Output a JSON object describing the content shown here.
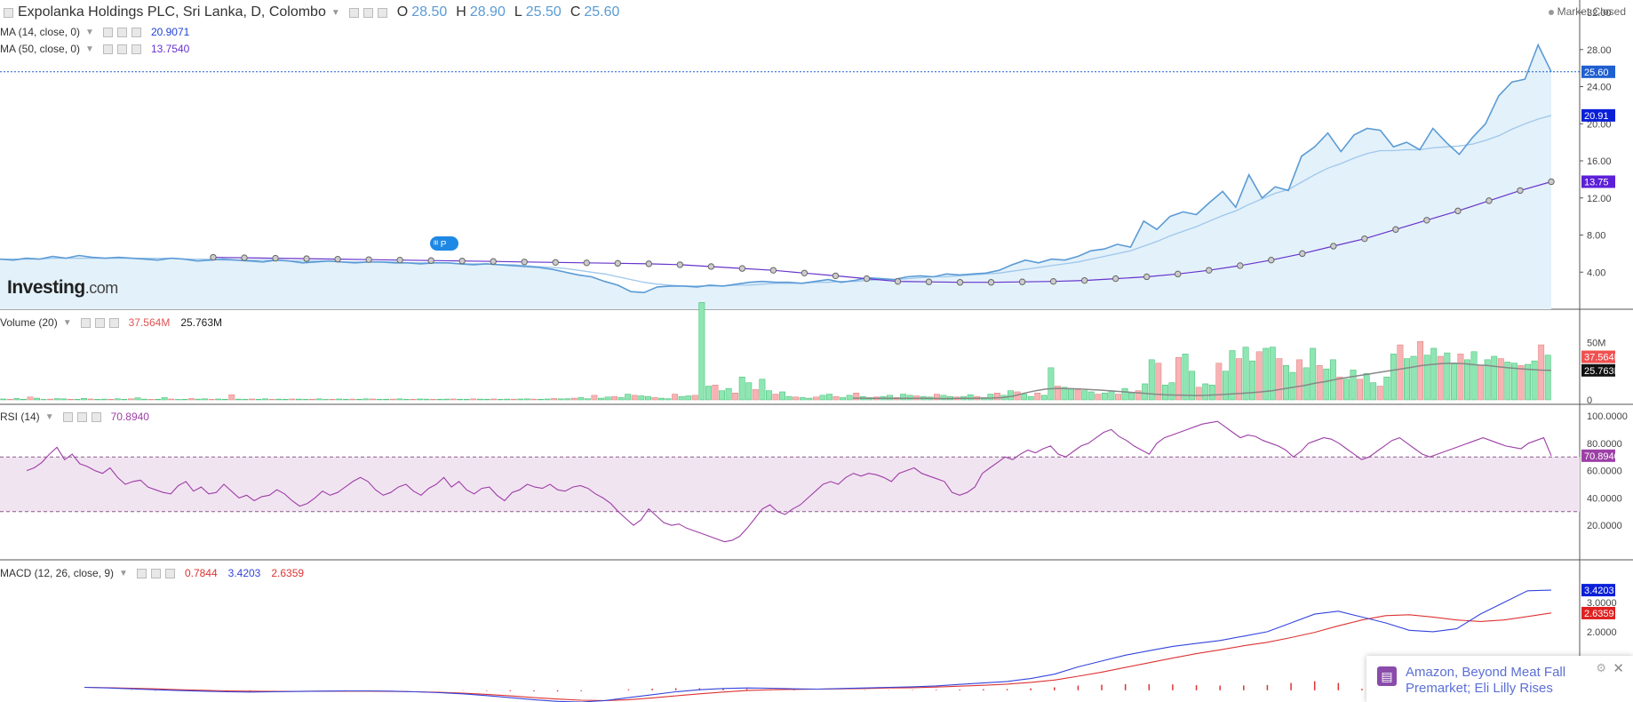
{
  "header": {
    "symbol": "Expolanka Holdings PLC, Sri Lanka, D, Colombo",
    "o_label": "O",
    "o_value": "28.50",
    "h_label": "H",
    "h_value": "28.90",
    "l_label": "L",
    "l_value": "25.50",
    "c_label": "C",
    "c_value": "25.60",
    "market_status": "Market Closed",
    "logo_main": "Investing",
    "logo_domain": ".com",
    "ma14_label": "MA (14, close, 0)",
    "ma14_value": "20.9071",
    "ma50_label": "MA (50, close, 0)",
    "ma50_value": "13.7540",
    "volume_label": "Volume (20)",
    "volume_value1": "37.564M",
    "volume_value2": "25.763M",
    "rsi_label": "RSI (14)",
    "rsi_value": "70.8940",
    "macd_label": "MACD (12, 26, close, 9)",
    "macd_hist": "0.7844",
    "macd_line": "3.4203",
    "macd_signal": "2.6359",
    "marker_text": "ᴵᴵᴵ P"
  },
  "colors": {
    "price": "#5b9bd5",
    "price_fill": "#e3f1fa",
    "ma14": "#9fc7ec",
    "ma50": "#6633cc",
    "vol_up": "#8ee6b2",
    "vol_down": "#f7b3b3",
    "vol_ma": "#888888",
    "rsi": "#9d3fa6",
    "rsi_band": "#f1e4f1",
    "macd": "#3344dd",
    "signal": "#dd3333",
    "hist": "#dd3333",
    "tag_blue": "#1f5fd0",
    "tag_dark": "#0a1fd8",
    "tag_purple": "#5c1fd8"
  },
  "chart_data": [
    {
      "type": "line",
      "name": "price",
      "ylim": [
        0,
        32
      ],
      "yticks": [
        "4.00",
        "8.00",
        "12.00",
        "16.00",
        "20.00",
        "24.00",
        "28.00",
        "32.00"
      ],
      "tags": {
        "price": "25.60",
        "ma14": "20.91",
        "ma50": "13.75"
      },
      "series": [
        {
          "name": "price",
          "values": [
            5.4,
            5.3,
            5.5,
            5.4,
            5.7,
            5.5,
            5.8,
            5.6,
            5.5,
            5.6,
            5.5,
            5.4,
            5.3,
            5.5,
            5.4,
            5.2,
            5.3,
            5.4,
            5.3,
            5.2,
            5.1,
            5.3,
            5.2,
            5.0,
            5.1,
            5.2,
            5.1,
            5.0,
            5.1,
            5.1,
            5.0,
            5.0,
            4.9,
            5.0,
            5.0,
            4.9,
            4.8,
            4.9,
            4.8,
            4.7,
            4.6,
            4.5,
            4.3,
            4.0,
            3.7,
            3.5,
            3.0,
            2.6,
            1.9,
            1.8,
            2.4,
            2.5,
            2.5,
            2.4,
            2.6,
            2.5,
            2.7,
            2.9,
            3.0,
            2.9,
            2.9,
            2.8,
            3.0,
            3.2,
            2.9,
            3.1,
            3.4,
            3.3,
            3.2,
            3.5,
            3.6,
            3.5,
            3.8,
            3.7,
            3.8,
            3.9,
            4.2,
            4.8,
            5.3,
            5.0,
            5.4,
            5.3,
            5.7,
            6.3,
            6.5,
            7.0,
            6.7,
            9.5,
            8.6,
            10.0,
            10.5,
            10.2,
            11.5,
            12.7,
            11.0,
            14.5,
            12.0,
            13.2,
            12.8,
            16.5,
            17.5,
            19.0,
            17.0,
            18.8,
            19.5,
            19.3,
            17.5,
            18.0,
            17.2,
            19.5,
            18.0,
            16.7,
            18.5,
            20.0,
            23.0,
            24.5,
            24.8,
            28.5,
            25.6
          ]
        },
        {
          "name": "ma14",
          "values": [
            5.4,
            5.4,
            5.4,
            5.4,
            5.5,
            5.5,
            5.5,
            5.5,
            5.5,
            5.5,
            5.5,
            5.5,
            5.5,
            5.5,
            5.4,
            5.4,
            5.4,
            5.3,
            5.3,
            5.3,
            5.3,
            5.3,
            5.2,
            5.2,
            5.2,
            5.2,
            5.1,
            5.1,
            5.1,
            5.1,
            5.1,
            5.0,
            5.0,
            5.0,
            5.0,
            4.9,
            4.9,
            4.9,
            4.8,
            4.8,
            4.7,
            4.6,
            4.5,
            4.4,
            4.2,
            4.0,
            3.8,
            3.5,
            3.2,
            2.9,
            2.7,
            2.6,
            2.5,
            2.5,
            2.5,
            2.5,
            2.6,
            2.6,
            2.7,
            2.8,
            2.8,
            2.8,
            2.9,
            2.9,
            3.0,
            3.0,
            3.1,
            3.2,
            3.2,
            3.3,
            3.4,
            3.5,
            3.5,
            3.6,
            3.7,
            3.8,
            3.9,
            4.1,
            4.3,
            4.5,
            4.7,
            4.9,
            5.1,
            5.4,
            5.7,
            6.0,
            6.3,
            6.8,
            7.3,
            7.9,
            8.4,
            8.9,
            9.5,
            10.1,
            10.6,
            11.3,
            11.9,
            12.5,
            12.9,
            13.7,
            14.5,
            15.2,
            15.7,
            16.3,
            16.8,
            17.1,
            17.1,
            17.2,
            17.2,
            17.4,
            17.5,
            17.6,
            17.8,
            18.2,
            18.7,
            19.4,
            20.0,
            20.5,
            20.9
          ]
        },
        {
          "name": "ma50",
          "values": [
            5.6,
            5.55,
            5.5,
            5.45,
            5.4,
            5.35,
            5.3,
            5.25,
            5.2,
            5.15,
            5.1,
            5.05,
            5.0,
            4.95,
            4.9,
            4.8,
            4.6,
            4.4,
            4.2,
            3.9,
            3.6,
            3.3,
            3.0,
            2.95,
            2.9,
            2.9,
            2.95,
            3.0,
            3.1,
            3.3,
            3.5,
            3.8,
            4.2,
            4.7,
            5.3,
            6.0,
            6.8,
            7.6,
            8.6,
            9.6,
            10.6,
            11.7,
            12.8,
            13.75
          ]
        }
      ]
    },
    {
      "type": "bar",
      "name": "volume",
      "ylim": [
        0,
        62
      ],
      "yticks": [
        "0",
        "25M",
        "50M"
      ],
      "tags": {
        "v1": "37.564M",
        "v2": "25.763M"
      },
      "series": [
        {
          "name": "volume",
          "values": [
            0.8,
            0.5,
            1.2,
            0.6,
            2.5,
            1.5,
            0.4,
            0.7,
            1.1,
            0.9,
            0.6,
            0.5,
            1.3,
            0.8,
            0.5,
            0.7,
            0.6,
            1.0,
            0.5,
            0.9,
            1.8,
            0.7,
            0.5,
            0.6,
            2.0,
            0.8,
            0.4,
            0.6,
            1.2,
            0.7,
            0.9,
            0.5,
            0.8,
            0.6,
            4.5,
            0.7,
            0.5,
            0.8,
            0.6,
            0.9,
            0.5,
            0.7,
            0.6,
            0.8,
            0.7,
            0.5,
            0.6,
            0.9,
            0.4,
            0.6,
            0.8,
            0.5,
            0.7,
            0.6,
            0.9,
            0.8,
            0.5,
            0.6,
            0.7,
            0.9,
            0.5,
            0.6,
            0.8,
            0.7,
            0.5,
            0.6,
            0.7,
            0.8,
            0.6,
            0.5,
            0.9,
            0.7,
            0.6,
            0.8,
            0.5,
            0.7,
            0.6,
            0.8,
            0.9,
            0.7,
            0.6,
            0.8,
            1.2,
            0.9,
            1.0,
            1.5,
            2.0,
            1.0,
            4.0,
            1.5,
            2.5,
            3.0,
            2.0,
            5.0,
            4.0,
            3.5,
            3.0,
            2.0,
            1.5,
            1.0,
            5.0,
            3.0,
            3.5,
            4.0,
            85.0,
            12.0,
            13.0,
            8.0,
            10.0,
            6.0,
            20.0,
            15.0,
            9.0,
            18.0,
            8.0,
            5.0,
            7.0,
            3.0,
            2.5,
            2.0,
            1.5,
            2.5,
            4.0,
            5.0,
            3.0,
            2.0,
            4.0,
            6.0,
            3.0,
            2.0,
            2.5,
            3.0,
            4.0,
            2.0,
            5.0,
            4.0,
            3.5,
            3.0,
            2.5,
            5.0,
            4.0,
            3.0,
            2.5,
            3.0,
            4.5,
            3.0,
            2.0,
            5.0,
            6.0,
            4.0,
            8.0,
            7.0,
            5.0,
            3.0,
            6.0,
            4.0,
            28.0,
            12.0,
            11.0,
            10.0,
            9.0,
            8.0,
            7.0,
            5.0,
            6.0,
            8.0,
            5.0,
            10.0,
            6.0,
            8.0,
            14.0,
            35.0,
            32.0,
            13.0,
            15.0,
            37.0,
            40.0,
            25.0,
            11.0,
            14.0,
            13.0,
            32.0,
            25.0,
            43.0,
            36.0,
            46.0,
            34.0,
            42.0,
            45.0,
            46.0,
            36.0,
            30.0,
            24.0,
            35.0,
            28.0,
            45.0,
            30.0,
            27.0,
            35.0,
            20.0,
            18.0,
            26.0,
            18.0,
            23.0,
            15.0,
            12.0,
            20.0,
            40.0,
            48.0,
            36.0,
            38.0,
            51.0,
            39.0,
            45.0,
            38.0,
            41.0,
            32.0,
            40.0,
            35.0,
            42.0,
            30.0,
            35.0,
            38.0,
            36.0,
            33.0,
            32.0,
            30.0,
            31.0,
            34.0,
            48.0,
            39.0
          ]
        },
        {
          "name": "volume-ma",
          "values": [
            1.5,
            1.5,
            1.4,
            1.4,
            1.4,
            1.3,
            1.3,
            1.3,
            1.2,
            1.2,
            1.3,
            1.4,
            1.5,
            1.6,
            2.0,
            3.5,
            6.0,
            8.0,
            9.5,
            10.0,
            9.8,
            9.6,
            9.0,
            8.5,
            7.8,
            7.2,
            6.5,
            5.8,
            5.0,
            4.5,
            4.2,
            4.0,
            3.8,
            4.0,
            4.5,
            5.0,
            5.6,
            6.2,
            7.0,
            8.0,
            9.5,
            11.0,
            12.5,
            14.5,
            16.0,
            18.0,
            19.5,
            21.0,
            22.5,
            24.0,
            25.5,
            27.0,
            28.5,
            30.0,
            31.0,
            31.8,
            32.0,
            31.5,
            30.5,
            30.0,
            29.0,
            28.0,
            27.2,
            26.5,
            26.0,
            25.8
          ]
        }
      ]
    },
    {
      "type": "line",
      "name": "rsi",
      "ylim": [
        0,
        100
      ],
      "yticks": [
        "20.0000",
        "40.0000",
        "60.0000",
        "80.0000",
        "100.0000"
      ],
      "band": [
        30,
        70
      ],
      "tag": "70.8940",
      "series": [
        {
          "name": "rsi",
          "values": [
            60,
            62,
            66,
            72,
            77,
            68,
            72,
            65,
            63,
            60,
            58,
            62,
            55,
            50,
            52,
            53,
            48,
            46,
            44,
            43,
            49,
            52,
            45,
            48,
            43,
            44,
            50,
            45,
            40,
            42,
            38,
            41,
            42,
            46,
            43,
            38,
            34,
            36,
            40,
            45,
            42,
            44,
            48,
            52,
            55,
            52,
            46,
            42,
            44,
            48,
            50,
            45,
            42,
            47,
            50,
            55,
            48,
            52,
            46,
            43,
            47,
            48,
            42,
            38,
            44,
            46,
            50,
            48,
            47,
            50,
            46,
            45,
            48,
            49,
            47,
            43,
            40,
            36,
            30,
            25,
            20,
            24,
            32,
            27,
            22,
            20,
            21,
            18,
            16,
            14,
            12,
            10,
            8,
            9,
            12,
            18,
            25,
            32,
            35,
            30,
            28,
            32,
            35,
            40,
            45,
            50,
            52,
            50,
            55,
            58,
            56,
            58,
            57,
            55,
            52,
            58,
            60,
            62,
            58,
            56,
            54,
            52,
            44,
            42,
            44,
            48,
            58,
            62,
            66,
            70,
            68,
            72,
            75,
            73,
            76,
            78,
            72,
            70,
            74,
            78,
            80,
            84,
            88,
            90,
            85,
            82,
            78,
            75,
            72,
            80,
            84,
            86,
            88,
            90,
            92,
            94,
            95,
            96,
            92,
            88,
            84,
            86,
            85,
            82,
            80,
            78,
            75,
            70,
            74,
            80,
            82,
            84,
            83,
            80,
            76,
            72,
            68,
            70,
            74,
            78,
            82,
            84,
            80,
            76,
            72,
            70,
            72,
            74,
            76,
            78,
            80,
            82,
            84,
            82,
            80,
            78,
            77,
            76,
            80,
            82,
            84,
            70.9
          ]
        }
      ]
    },
    {
      "type": "line",
      "name": "macd",
      "ylim": [
        -0.4,
        4.0
      ],
      "yticks": [
        "1.0000",
        "2.0000",
        "3.0000"
      ],
      "tags": {
        "macd": "3.4203",
        "signal": "2.6359"
      },
      "series": [
        {
          "name": "macd",
          "values": [
            0.1,
            0.08,
            0.05,
            0.02,
            -0.01,
            -0.03,
            -0.05,
            -0.06,
            -0.05,
            -0.04,
            -0.03,
            -0.02,
            -0.02,
            -0.03,
            -0.05,
            -0.08,
            -0.12,
            -0.18,
            -0.25,
            -0.32,
            -0.38,
            -0.4,
            -0.35,
            -0.25,
            -0.15,
            -0.05,
            0.02,
            0.06,
            0.08,
            0.07,
            0.05,
            0.04,
            0.06,
            0.08,
            0.1,
            0.12,
            0.15,
            0.2,
            0.25,
            0.3,
            0.4,
            0.55,
            0.8,
            1.0,
            1.2,
            1.35,
            1.5,
            1.6,
            1.7,
            1.85,
            2.0,
            2.3,
            2.6,
            2.7,
            2.5,
            2.3,
            2.05,
            2.0,
            2.1,
            2.6,
            3.0,
            3.4,
            3.42
          ]
        },
        {
          "name": "signal",
          "values": [
            0.1,
            0.09,
            0.07,
            0.05,
            0.02,
            0.0,
            -0.02,
            -0.03,
            -0.04,
            -0.04,
            -0.03,
            -0.03,
            -0.03,
            -0.04,
            -0.05,
            -0.07,
            -0.1,
            -0.14,
            -0.19,
            -0.25,
            -0.3,
            -0.34,
            -0.35,
            -0.32,
            -0.26,
            -0.19,
            -0.12,
            -0.06,
            -0.01,
            0.02,
            0.03,
            0.04,
            0.05,
            0.06,
            0.08,
            0.09,
            0.11,
            0.14,
            0.17,
            0.21,
            0.27,
            0.35,
            0.48,
            0.62,
            0.78,
            0.94,
            1.1,
            1.25,
            1.38,
            1.52,
            1.64,
            1.8,
            1.98,
            2.2,
            2.4,
            2.55,
            2.58,
            2.5,
            2.4,
            2.35,
            2.4,
            2.52,
            2.64
          ]
        }
      ]
    }
  ]
}
